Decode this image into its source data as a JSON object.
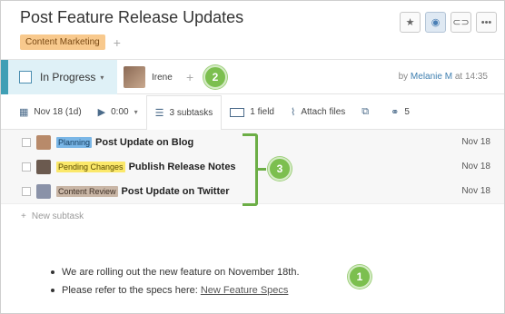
{
  "header": {
    "title": "Post Feature Release Updates",
    "tag": "Content Marketing",
    "tag_add": "+",
    "buttons": {
      "star": "★",
      "rss": "◉",
      "link": "⊂⊃",
      "more": "•••"
    }
  },
  "status": {
    "label": "In Progress",
    "caret": "▾",
    "assignee": "Irene",
    "add": "+",
    "byline_prefix": "by",
    "author": "Melanie M",
    "time": "at 14:35"
  },
  "toolbar": {
    "date": "Nov 18 (1d)",
    "timer": "0:00",
    "timer_caret": "▾",
    "subtasks": "3 subtasks",
    "field": "1 field",
    "attach": "Attach files",
    "shares": "5"
  },
  "subtasks": [
    {
      "tag": "Planning",
      "tag_bg": "#7ab6e6",
      "tag_fg": "#123a5c",
      "name": "Post Update on Blog",
      "date": "Nov 18",
      "avatar_color": "#b88a6a"
    },
    {
      "tag": "Pending Changes",
      "tag_bg": "#fbe86a",
      "tag_fg": "#5a4b00",
      "name": "Publish Release Notes",
      "date": "Nov 18",
      "avatar_color": "#6b5a4f"
    },
    {
      "tag": "Content Review",
      "tag_bg": "#c9b6a6",
      "tag_fg": "#3e2f24",
      "name": "Post Update on Twitter",
      "date": "Nov 18",
      "avatar_color": "#8a92a8"
    }
  ],
  "new_subtask": {
    "plus": "+",
    "label": "New subtask"
  },
  "callouts": {
    "one": "1",
    "two": "2",
    "three": "3"
  },
  "description": {
    "line1": "We are rolling out the new feature on November 18th.",
    "line2": "Please refer to the specs here:",
    "link": "New Feature Specs"
  }
}
